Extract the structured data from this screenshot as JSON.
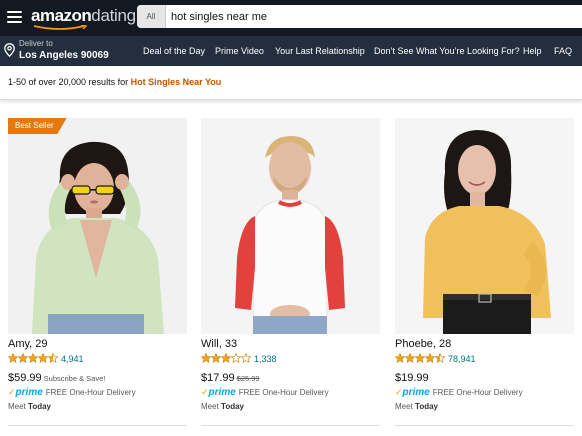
{
  "header": {
    "logo_part1": "amazon",
    "logo_part2": "dating",
    "search_category": "All",
    "search_value": "hot singles near me"
  },
  "nav": {
    "deliver_to": "Deliver to",
    "location": "Los Angeles 90069",
    "links": [
      "Deal of the Day",
      "Prime Video",
      "Your Last Relationship",
      "Don’t See What You’re Looking For?",
      "Help",
      "FAQ"
    ]
  },
  "results": {
    "summary": "1-50 of over 20,000 results for",
    "query": "Hot Singles Near You"
  },
  "colors": {
    "header_bg": "#131921",
    "nav_bg": "#232f3e",
    "accent_orange": "#e47911",
    "link_teal": "#007185",
    "prime_blue": "#00a8e1",
    "star_gold": "#f2a41f"
  },
  "products": [
    {
      "badge": "Best Seller",
      "name": "Amy, 29",
      "rating": 4.5,
      "rating_count": "4,941",
      "price": "$59.99",
      "price_note": "Subscribe & Save!",
      "price_strike": "",
      "prime_check": "✓",
      "prime_label": "prime",
      "delivery": "FREE One-Hour Delivery",
      "meet_prefix": "Meet",
      "meet_day": "Today",
      "image_icon": "woman-in-green-cardigan-with-sunglasses"
    },
    {
      "badge": "",
      "name": "Will, 33",
      "rating": 3,
      "rating_count": "1,338",
      "price": "$17.99",
      "price_note": "",
      "price_strike": "$25.99",
      "prime_check": "✓",
      "prime_label": "prime",
      "delivery": "FREE One-Hour Delivery",
      "meet_prefix": "Meet",
      "meet_day": "Today",
      "image_icon": "man-in-red-raglan-shirt"
    },
    {
      "badge": "",
      "name": "Phoebe, 28",
      "rating": 4.5,
      "rating_count": "78,941",
      "price": "$19.99",
      "price_note": "",
      "price_strike": "",
      "prime_check": "✓",
      "prime_label": "prime",
      "delivery": "FREE One-Hour Delivery",
      "meet_prefix": "Meet",
      "meet_day": "Today",
      "image_icon": "woman-in-yellow-sweater"
    }
  ]
}
